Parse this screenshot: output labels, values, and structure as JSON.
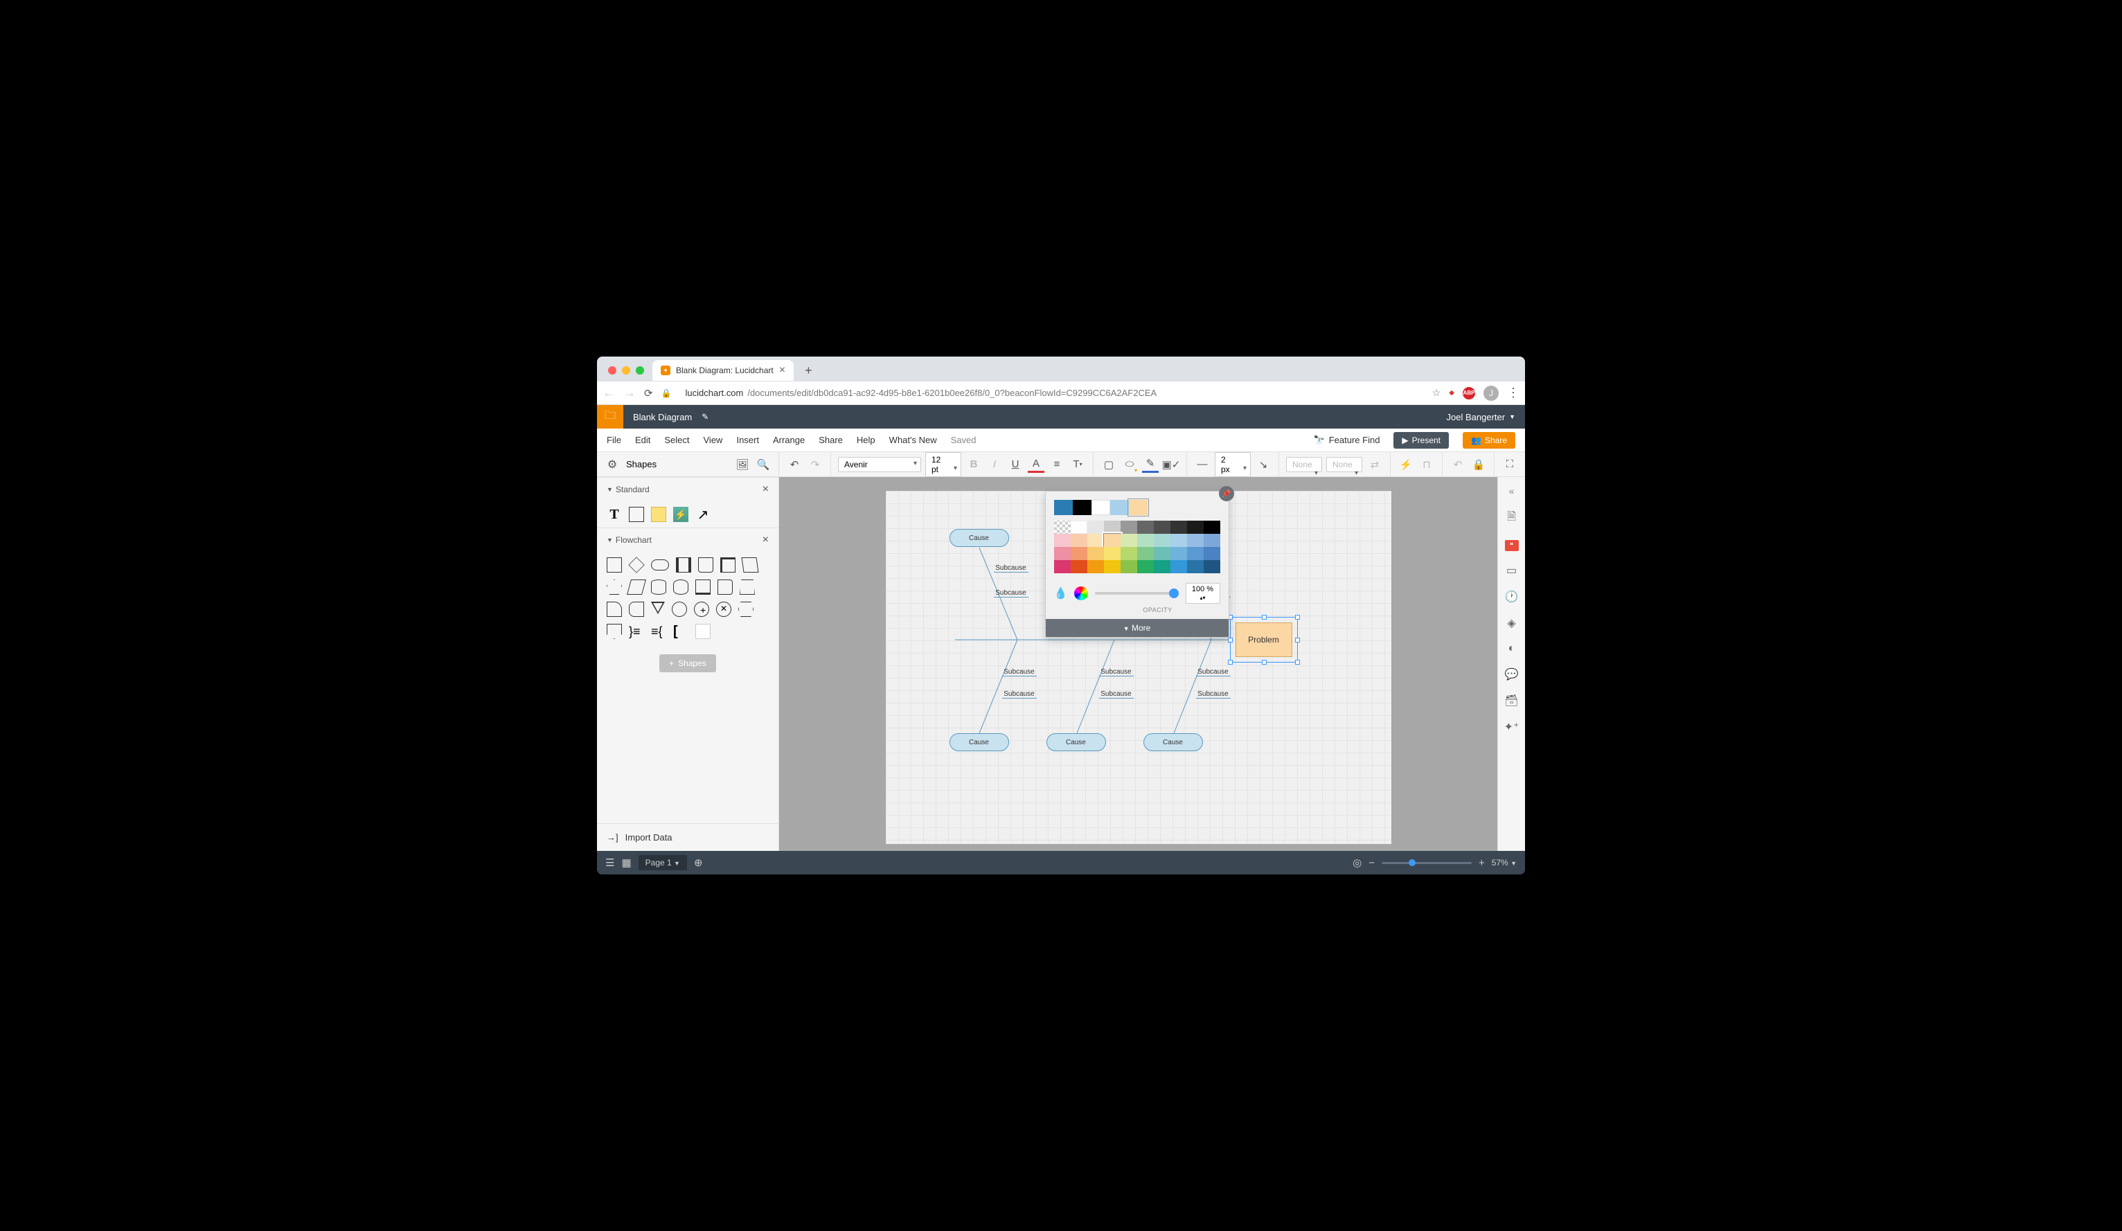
{
  "browser": {
    "tab_title": "Blank Diagram: Lucidchart",
    "url_host": "lucidchart.com",
    "url_path": "/documents/edit/db0dca91-ac92-4d95-b8e1-6201b0ee26f8/0_0?beaconFlowId=C9299CC6A2AF2CEA",
    "avatar_initial": "J"
  },
  "header": {
    "doc_title": "Blank Diagram",
    "user_name": "Joel Bangerter"
  },
  "menu": {
    "items": [
      "File",
      "Edit",
      "Select",
      "View",
      "Insert",
      "Arrange",
      "Share",
      "Help",
      "What's New"
    ],
    "saved": "Saved",
    "feature_find": "Feature Find",
    "present": "Present",
    "share": "Share"
  },
  "toolbar": {
    "shapes": "Shapes",
    "font": "Avenir",
    "font_size": "12 pt",
    "line_width": "2 px",
    "effect1": "None",
    "effect2": "None"
  },
  "panel": {
    "standard": "Standard",
    "flowchart": "Flowchart",
    "add_shapes": "Shapes",
    "import": "Import Data"
  },
  "canvas": {
    "cause": "Cause",
    "subcause": "Subcause",
    "problem": "Problem"
  },
  "color_picker": {
    "opacity_value": "100 %",
    "opacity_label": "OPACITY",
    "more": "More",
    "recent": [
      "#2b7cb3",
      "#000000",
      "#ffffff",
      "#a8d0eb",
      "#fbd7a3"
    ]
  },
  "bottom": {
    "page": "Page 1",
    "zoom": "57%"
  }
}
